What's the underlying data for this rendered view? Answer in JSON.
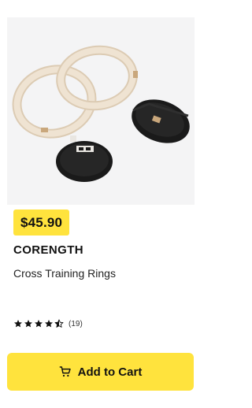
{
  "product": {
    "price": "$45.90",
    "brand": "CORENGTH",
    "name": "Cross Training Rings",
    "rating": 4.5,
    "review_count": "(19)"
  },
  "actions": {
    "add_to_cart_label": "Add to Cart"
  },
  "icons": {
    "cart": "cart-icon",
    "star": "star-icon"
  },
  "colors": {
    "accent": "#ffe33d",
    "image_background": "#f4f4f5",
    "strap": "#141414"
  }
}
